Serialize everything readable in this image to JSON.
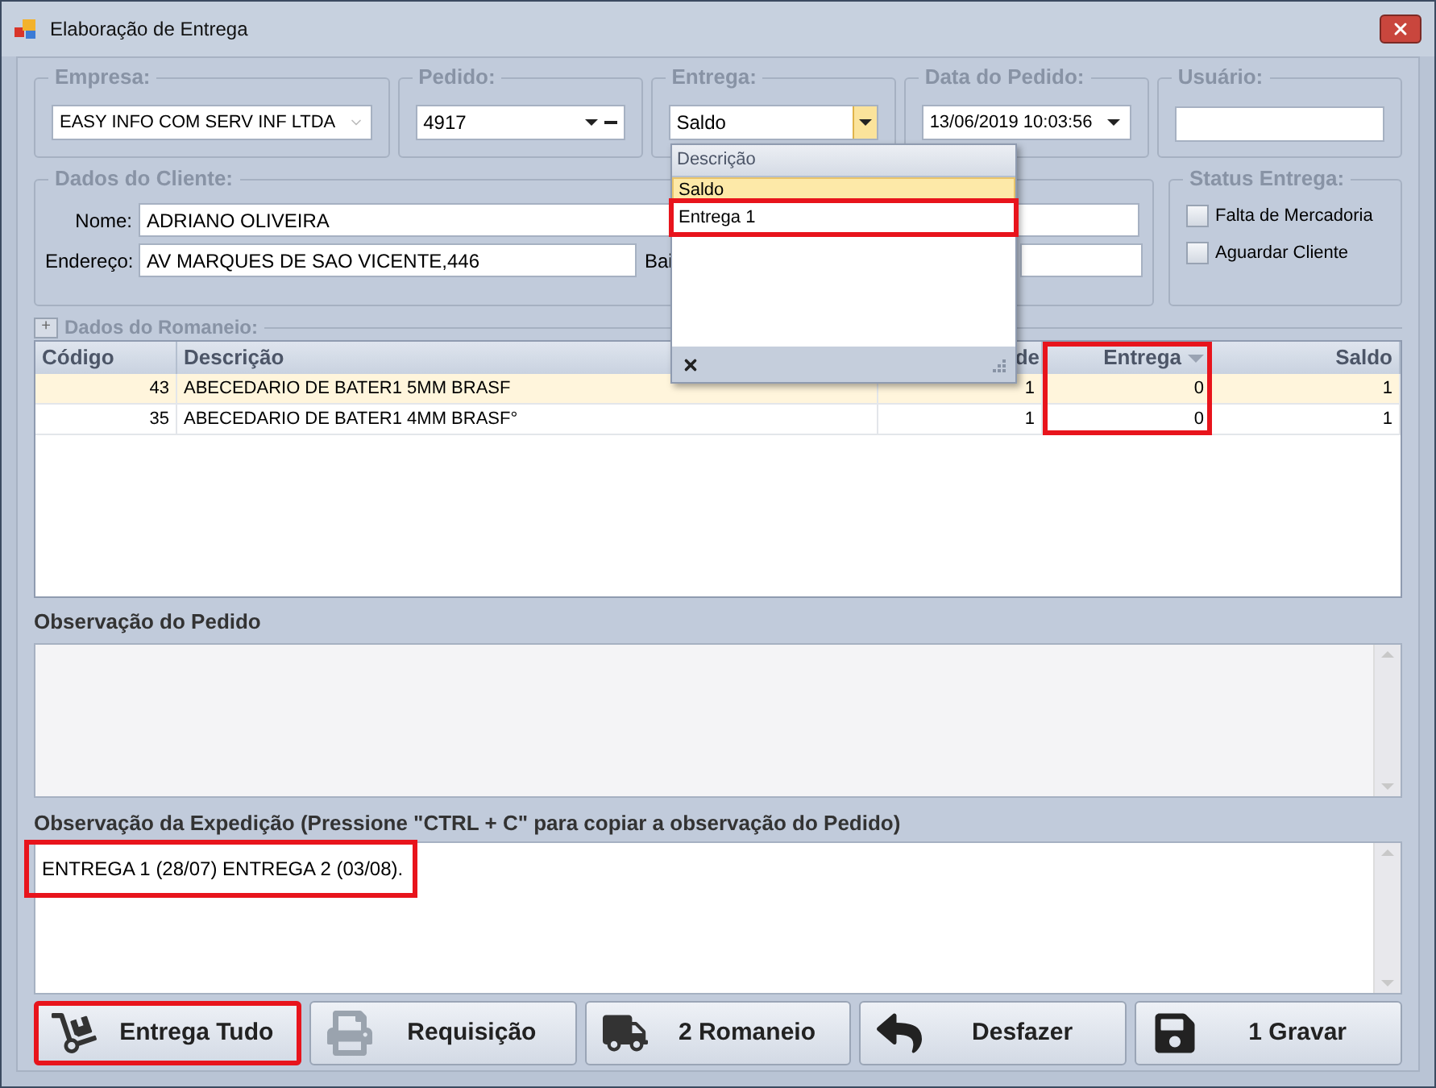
{
  "window": {
    "title": "Elaboração de Entrega"
  },
  "header_fields": [
    {
      "label": "Empresa:",
      "value": "EASY INFO COM  SERV INF LTDA",
      "kind": "combo-disabled"
    },
    {
      "label": "Pedido:",
      "value": "4917",
      "kind": "lookup"
    },
    {
      "label": "Entrega:",
      "value": "Saldo",
      "kind": "combo-open"
    },
    {
      "label": "Data do Pedido:",
      "value": "13/06/2019 10:03:56",
      "kind": "combo"
    },
    {
      "label": "Usuário:",
      "kind": "text"
    }
  ],
  "cliente": {
    "title": "Dados do Cliente:",
    "nome_label": "Nome:",
    "nome": "ADRIANO OLIVEIRA",
    "endereco_label": "Endereço:",
    "endereco": "AV MARQUES DE SAO VICENTE,446",
    "bairro_label": "Bai"
  },
  "status_entrega": {
    "title": "Status Entrega:",
    "options": [
      {
        "label": "Falta de Mercadoria",
        "checked": false
      },
      {
        "label": "Aguardar Cliente",
        "checked": false
      }
    ]
  },
  "romaneio": {
    "title": "Dados do Romaneio:",
    "expander": "+",
    "expanded": false
  },
  "table": {
    "columns": [
      {
        "label": "Código",
        "highlighted": false
      },
      {
        "label": "Descrição",
        "highlighted": false
      },
      {
        "label": "de",
        "highlighted": false
      },
      {
        "label": "Entrega",
        "highlighted": true
      },
      {
        "label": "Saldo",
        "highlighted": false
      }
    ],
    "rows": [
      {
        "selected": true,
        "cells": [
          "43",
          "ABECEDARIO DE BATER1 5MM BRASF",
          "1",
          "0",
          "1"
        ]
      },
      {
        "selected": false,
        "cells": [
          "35",
          "ABECEDARIO DE BATER1 4MM BRASF°",
          "1",
          "0",
          "1"
        ]
      }
    ]
  },
  "dropdown": {
    "header": "Descrição",
    "options": [
      {
        "label": "Saldo",
        "selected": true,
        "highlighted": false
      },
      {
        "label": "Entrega 1",
        "selected": false,
        "highlighted": true
      }
    ]
  },
  "observacao_pedido": {
    "label": "Observação do Pedido"
  },
  "observacao_expedicao": {
    "label": "Observação da Expedição (Pressione \"CTRL + C\" para copiar a observação do Pedido)",
    "value": "ENTREGA 1 (28/07) ENTREGA 2 (03/08).",
    "highlighted": true
  },
  "buttons": [
    {
      "label": "Entrega Tudo",
      "highlighted": true
    },
    {
      "label": "Requisição",
      "highlighted": false
    },
    {
      "label": "2 Romaneio",
      "highlighted": false
    },
    {
      "label": "Desfazer",
      "highlighted": false
    },
    {
      "label": "1 Gravar",
      "highlighted": false
    }
  ]
}
